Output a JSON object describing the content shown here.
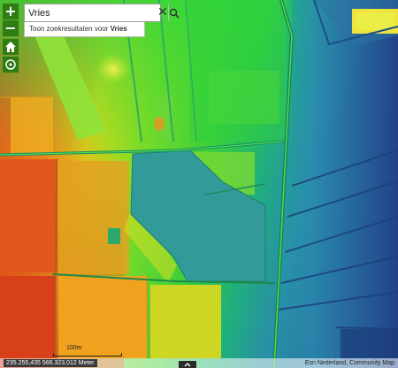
{
  "search": {
    "value": "Vries",
    "placeholder": ""
  },
  "suggestion": {
    "prefix": "Toon zoekresultaten voor",
    "term": "Vries"
  },
  "controls": {
    "zoom_in": "+",
    "zoom_out": "−"
  },
  "scale_bar": {
    "label": "100m"
  },
  "coordinates": "235.255,435 566.323,012 Meter",
  "attribution": "Esri Nederland, Community Map",
  "colors": {
    "control_bg": "#2f7b14",
    "water": "#339a9a"
  },
  "icons": {
    "zoom_in": "plus-icon",
    "zoom_out": "minus-icon",
    "home": "home-icon",
    "locate": "locate-icon",
    "search": "search-icon",
    "clear": "close-icon",
    "expand": "chevron-up-icon"
  }
}
